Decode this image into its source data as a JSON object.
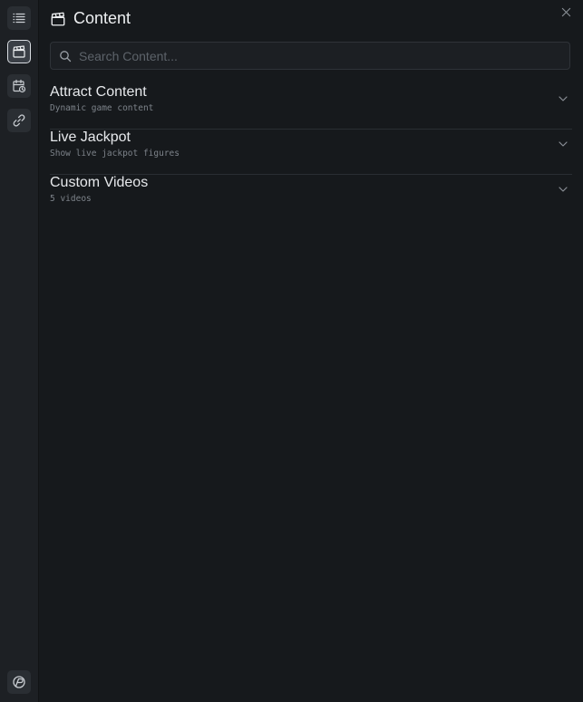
{
  "header": {
    "title": "Content",
    "icon": "clapperboard-icon"
  },
  "search": {
    "placeholder": "Search Content...",
    "value": ""
  },
  "rail": {
    "items": [
      {
        "icon": "list-icon",
        "active": false
      },
      {
        "icon": "clapperboard-icon",
        "active": true
      },
      {
        "icon": "calendar-clock-icon",
        "active": false
      },
      {
        "icon": "link-icon",
        "active": false
      }
    ],
    "footer_icon": "logo-icon"
  },
  "sections": [
    {
      "title": "Attract Content",
      "subtitle": "Dynamic game content"
    },
    {
      "title": "Live Jackpot",
      "subtitle": "Show live jackpot figures"
    },
    {
      "title": "Custom Videos",
      "subtitle": "5 videos"
    }
  ],
  "colors": {
    "panel_bg": "#16191c",
    "rail_bg": "#1d2024",
    "text": "#e7e9ec",
    "muted": "#7d838a"
  }
}
